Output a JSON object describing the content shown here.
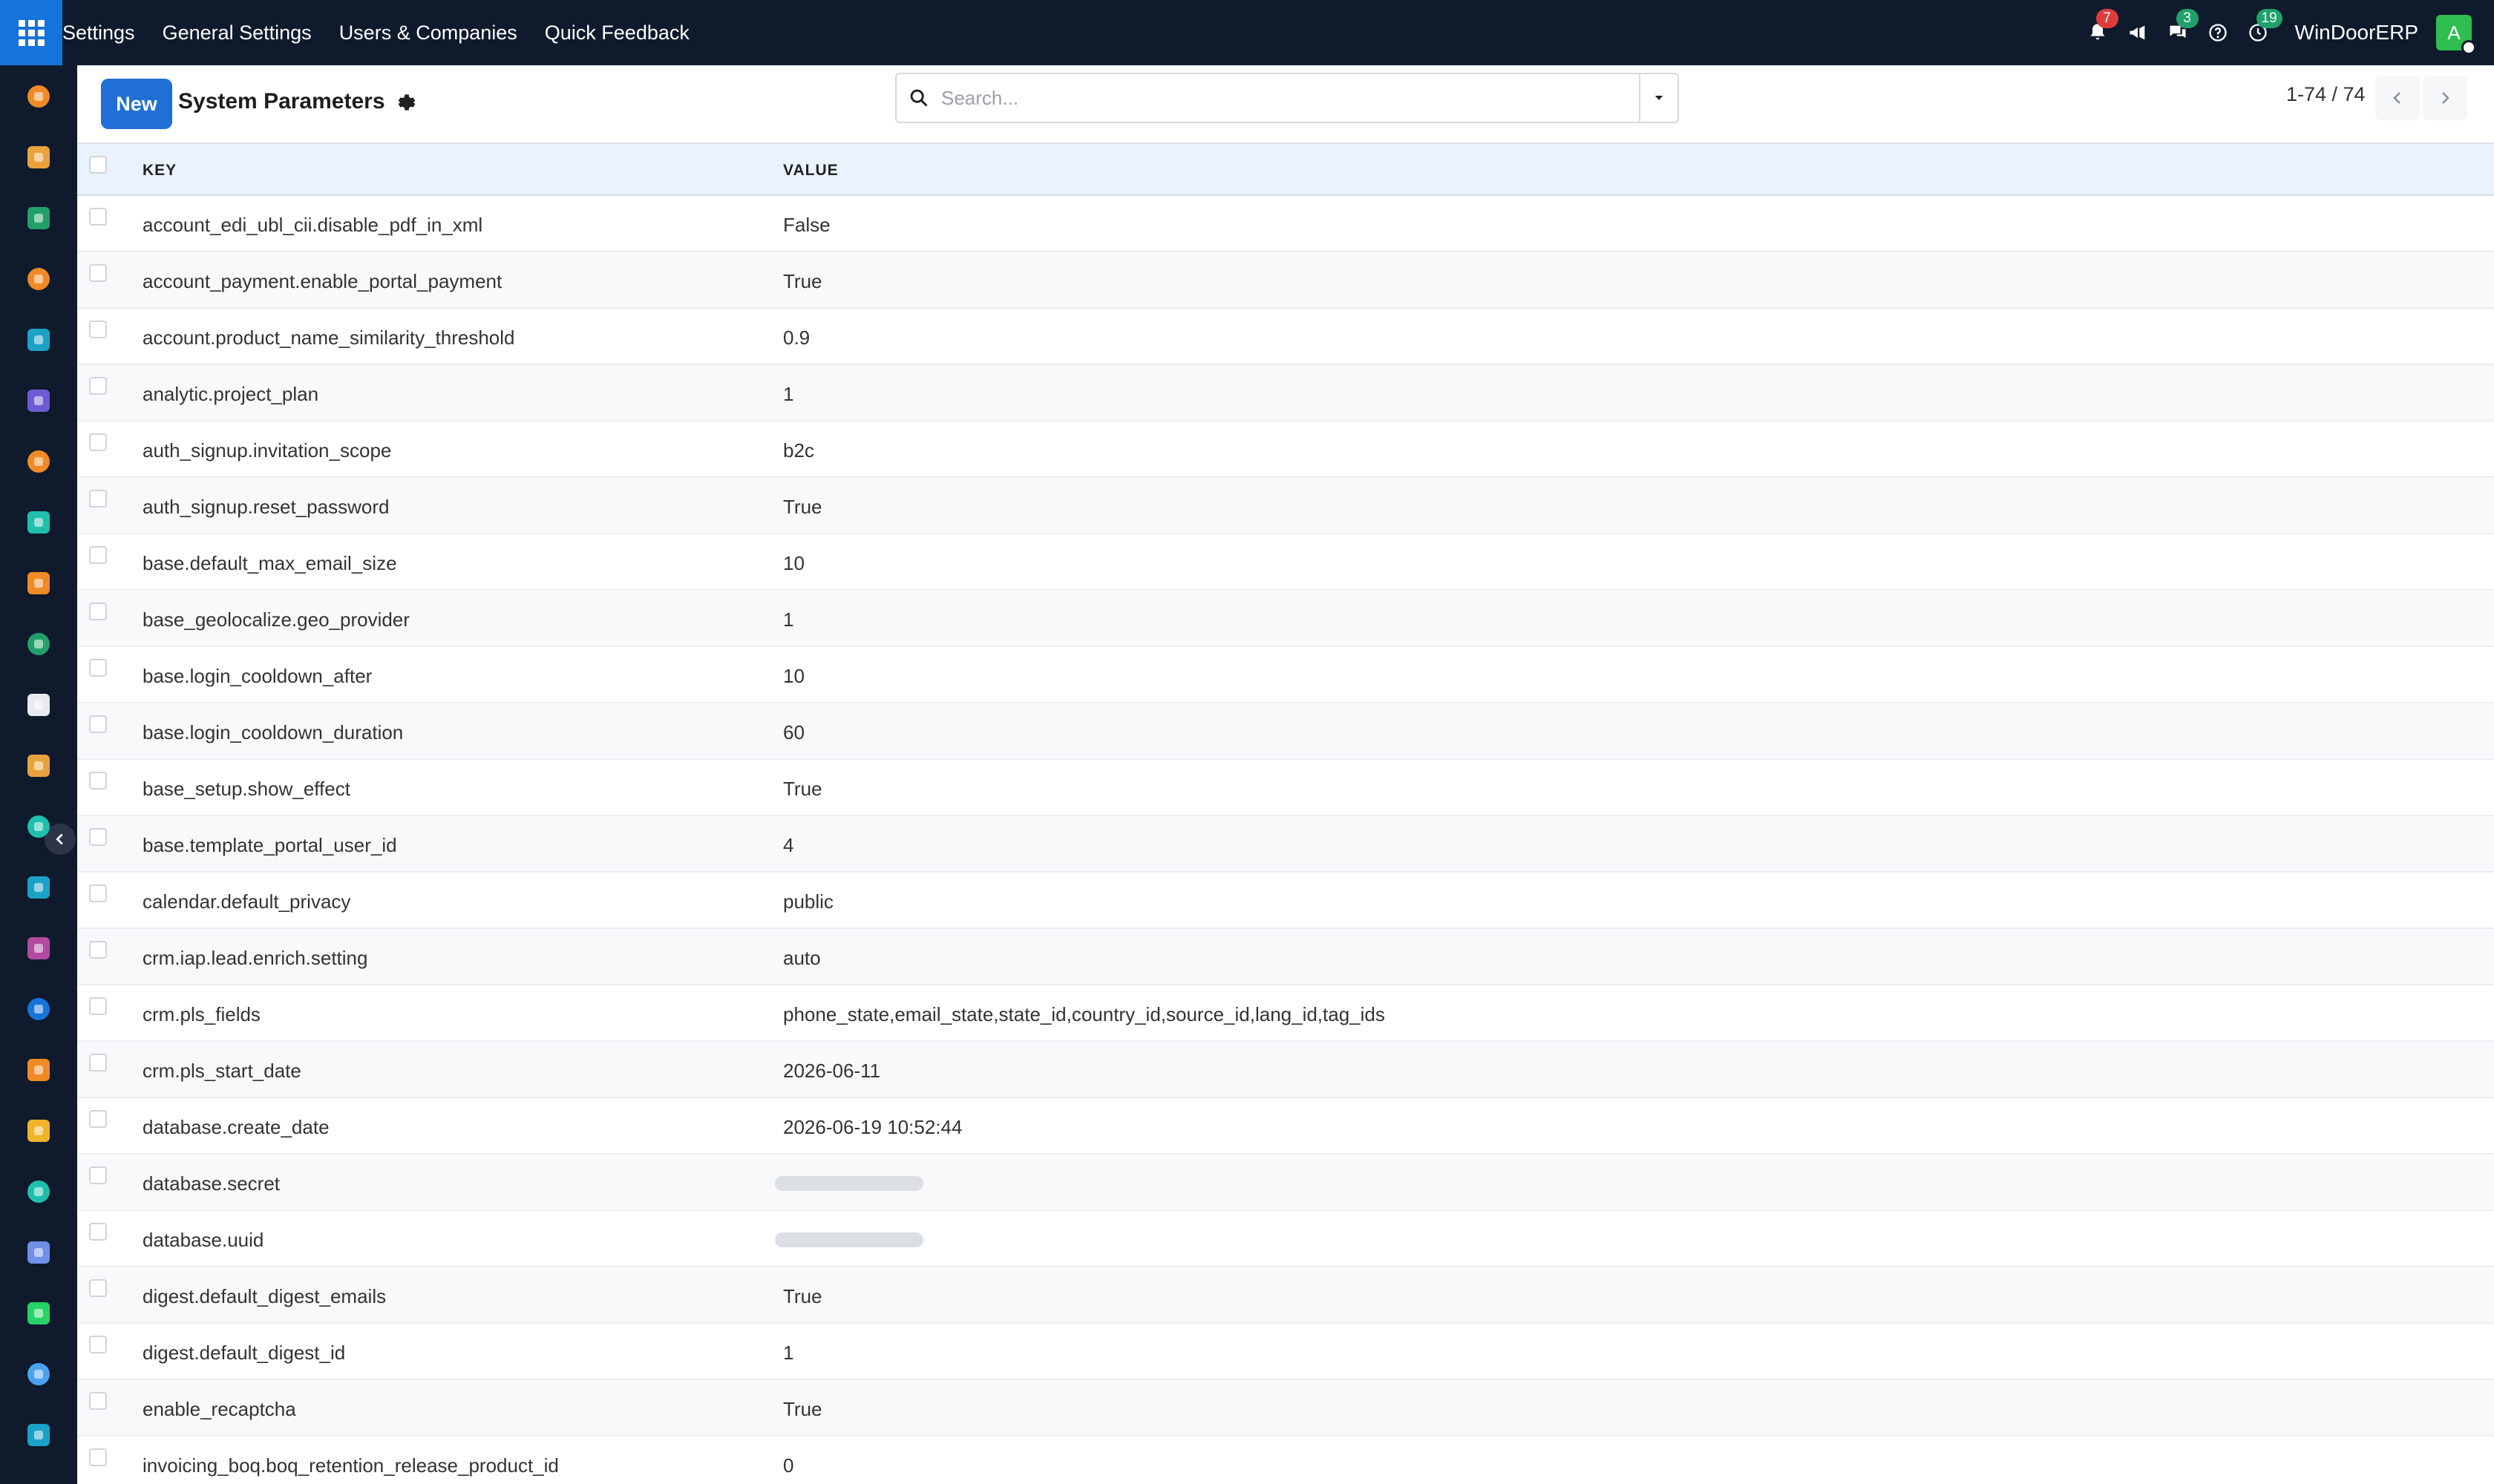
{
  "navbar": {
    "menus": [
      "Settings",
      "General Settings",
      "Users & Companies",
      "Quick Feedback"
    ],
    "notifications_badge": "7",
    "messages_badge": "3",
    "activities_badge": "19",
    "company": "WinDoorERP",
    "avatar_initial": "A"
  },
  "control": {
    "new_label": "New",
    "title": "System Parameters",
    "search_placeholder": "Search...",
    "pager": "1-74 / 74"
  },
  "table": {
    "columns": {
      "key": "KEY",
      "value": "VALUE"
    },
    "rows": [
      {
        "key": "account_edi_ubl_cii.disable_pdf_in_xml",
        "value": "False"
      },
      {
        "key": "account_payment.enable_portal_payment",
        "value": "True"
      },
      {
        "key": "account.product_name_similarity_threshold",
        "value": "0.9"
      },
      {
        "key": "analytic.project_plan",
        "value": "1"
      },
      {
        "key": "auth_signup.invitation_scope",
        "value": "b2c"
      },
      {
        "key": "auth_signup.reset_password",
        "value": "True"
      },
      {
        "key": "base.default_max_email_size",
        "value": "10"
      },
      {
        "key": "base_geolocalize.geo_provider",
        "value": "1"
      },
      {
        "key": "base.login_cooldown_after",
        "value": "10"
      },
      {
        "key": "base.login_cooldown_duration",
        "value": "60"
      },
      {
        "key": "base_setup.show_effect",
        "value": "True"
      },
      {
        "key": "base.template_portal_user_id",
        "value": "4"
      },
      {
        "key": "calendar.default_privacy",
        "value": "public"
      },
      {
        "key": "crm.iap.lead.enrich.setting",
        "value": "auto"
      },
      {
        "key": "crm.pls_fields",
        "value": "phone_state,email_state,state_id,country_id,source_id,lang_id,tag_ids"
      },
      {
        "key": "crm.pls_start_date",
        "value": "2026-06-11"
      },
      {
        "key": "database.create_date",
        "value": "2026-06-19 10:52:44"
      },
      {
        "key": "database.secret",
        "value": ""
      },
      {
        "key": "database.uuid",
        "value": ""
      },
      {
        "key": "digest.default_digest_emails",
        "value": "True"
      },
      {
        "key": "digest.default_digest_id",
        "value": "1"
      },
      {
        "key": "enable_recaptcha",
        "value": "True"
      },
      {
        "key": "invoicing_boq.boq_retention_release_product_id",
        "value": "0"
      }
    ]
  },
  "sidebar": {
    "apps": [
      {
        "icon": "invoicing-icon",
        "color": "#f08a24"
      },
      {
        "icon": "discuss-icon",
        "color": "#e9a23b"
      },
      {
        "icon": "contacts-icon",
        "color": "#22a06b"
      },
      {
        "icon": "crm-icon",
        "color": "#f08a24"
      },
      {
        "icon": "website-icon",
        "color": "#1ba1c7"
      },
      {
        "icon": "email-marketing-icon",
        "color": "#6f5bd3"
      },
      {
        "icon": "livechat-icon",
        "color": "#f08a24"
      },
      {
        "icon": "project-icon",
        "color": "#1fbfae"
      },
      {
        "icon": "accounting-icon",
        "color": "#f08a24"
      },
      {
        "icon": "employees-icon",
        "color": "#22a06b"
      },
      {
        "icon": "inventory-icon",
        "color": "#e8eaee"
      },
      {
        "icon": "sales-icon",
        "color": "#e9a23b"
      },
      {
        "icon": "todo-icon",
        "color": "#1fbfae"
      },
      {
        "icon": "knowledge-icon",
        "color": "#1ba1c7"
      },
      {
        "icon": "purchase-icon",
        "color": "#b24aa0"
      },
      {
        "icon": "expenses-icon",
        "color": "#1573dc"
      },
      {
        "icon": "team-icon",
        "color": "#f08a24"
      },
      {
        "icon": "calendar-icon",
        "color": "#f0b429"
      },
      {
        "icon": "sign-icon",
        "color": "#1fbfae"
      },
      {
        "icon": "dashboards-icon",
        "color": "#6f8fe8"
      },
      {
        "icon": "whatsapp-icon",
        "color": "#25d366"
      },
      {
        "icon": "timesheet-icon",
        "color": "#4aa3f0"
      },
      {
        "icon": "website-2-icon",
        "color": "#1ba1c7"
      }
    ]
  }
}
